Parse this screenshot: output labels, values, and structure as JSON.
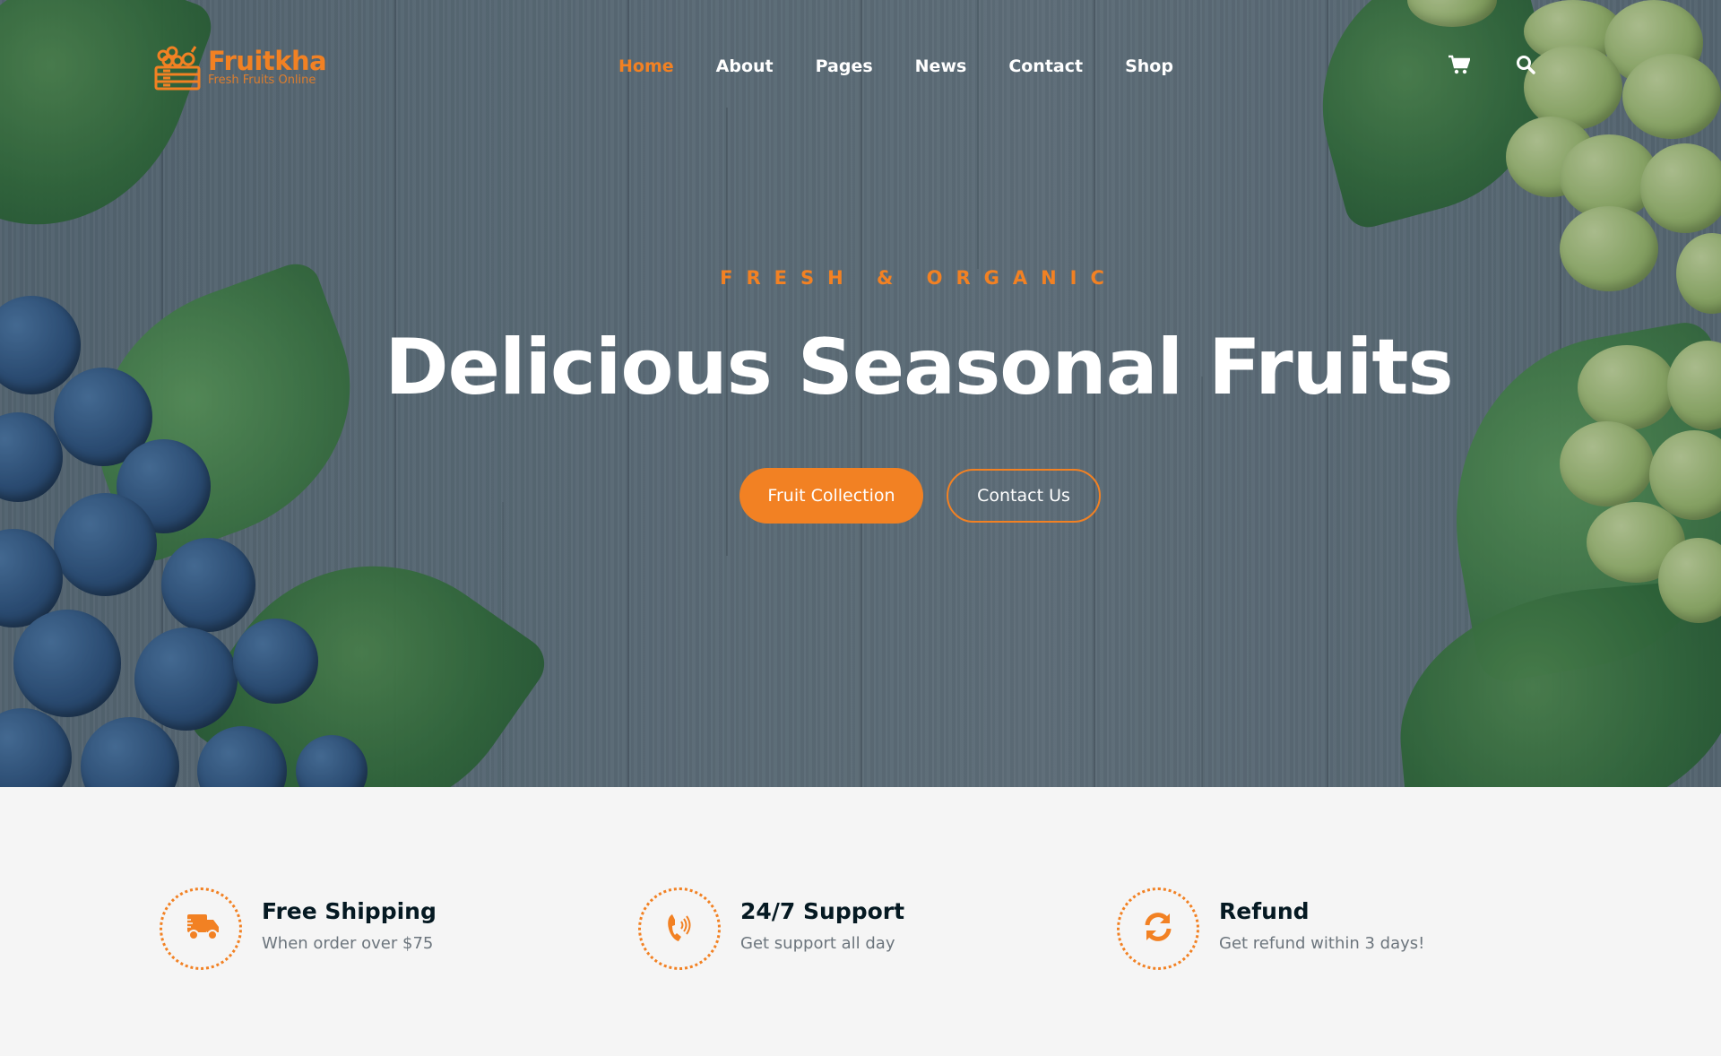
{
  "brand": {
    "name": "Fruitkha",
    "tagline": "Fresh Fruits Online",
    "accent_color": "#f28123",
    "dark_text_color": "#051922"
  },
  "nav": {
    "items": [
      {
        "label": "Home",
        "active": true
      },
      {
        "label": "About",
        "active": false
      },
      {
        "label": "Pages",
        "active": false
      },
      {
        "label": "News",
        "active": false
      },
      {
        "label": "Contact",
        "active": false
      },
      {
        "label": "Shop",
        "active": false
      }
    ],
    "icons": [
      "shopping-cart-icon",
      "search-icon"
    ]
  },
  "hero": {
    "subtitle": "Fresh & Organic",
    "title": "Delicious Seasonal Fruits",
    "buttons": {
      "primary": "Fruit Collection",
      "secondary": "Contact Us"
    }
  },
  "features": [
    {
      "icon": "shipping-truck-icon",
      "title": "Free Shipping",
      "description": "When order over $75"
    },
    {
      "icon": "phone-volume-icon",
      "title": "24/7 Support",
      "description": "Get support all day"
    },
    {
      "icon": "refresh-icon",
      "title": "Refund",
      "description": "Get refund within 3 days!"
    }
  ]
}
